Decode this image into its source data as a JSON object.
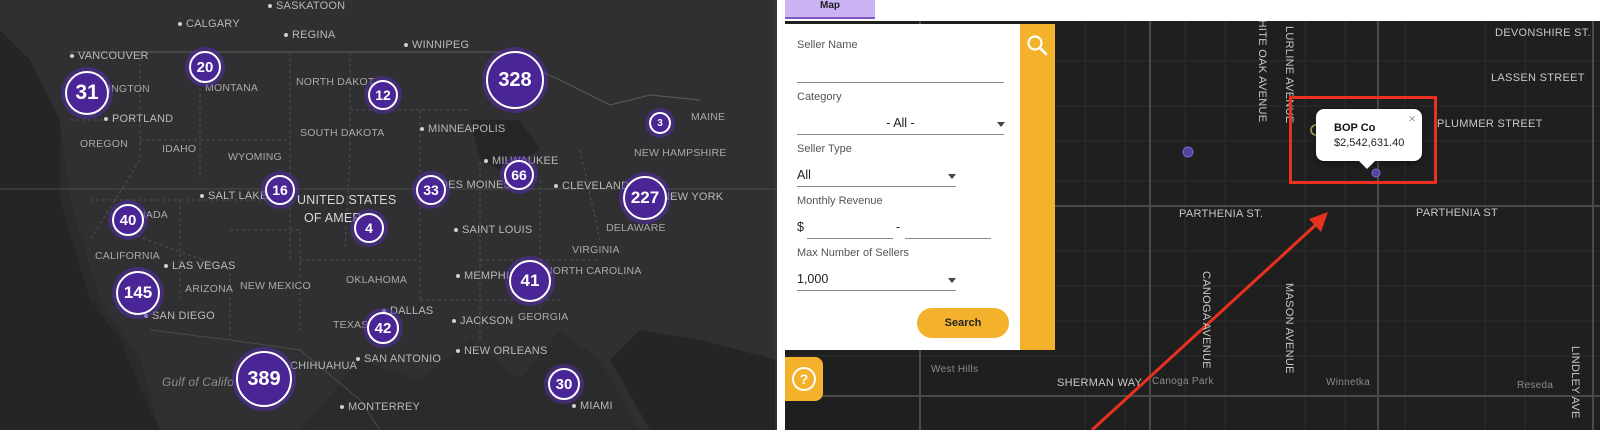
{
  "left_map": {
    "country_labels": [
      "UNITED STATES",
      "OF AMER"
    ],
    "gulf_label": "Gulf of Califo",
    "state_labels": [
      "NORTH DAKOT",
      "MONTANA",
      "SOUTH DAKOTA",
      "WYOMING",
      "IDAHO",
      "OREGON",
      "CALIFORNIA",
      "ARIZONA",
      "NEW MEXICO",
      "OKLAHOMA",
      "TEXAS",
      "GEORGIA",
      "NORTH CAROLINA",
      "VIRGINIA",
      "NEW HAMPSHIRE",
      "MAINE",
      "DELAWARE",
      "NADA",
      "INGTON"
    ],
    "city_labels": [
      "CALGARY",
      "SASKATOON",
      "REGINA",
      "WINNIPEG",
      "VANCOUVER",
      "PORTLAND",
      "MINNEAPOLIS",
      "MILWAUKEE",
      "DES MOINES",
      "SALT LAKE",
      "CLEVELAND",
      "NEW YORK",
      "SAINT LOUIS",
      "LAS VEGAS",
      "SAN DIEGO",
      "MEMPHIS",
      "JACKSON",
      "DALLAS",
      "SAN ANTONIO",
      "NEW ORLEANS",
      "MIAMI",
      "MONTERREY",
      "CHIHUAHUA"
    ],
    "clusters": [
      "31",
      "20",
      "328",
      "12",
      "3",
      "66",
      "33",
      "16",
      "227",
      "40",
      "4",
      "145",
      "41",
      "42",
      "389",
      "30"
    ]
  },
  "tabs": {
    "map_label": "Map"
  },
  "filters": {
    "seller_name_label": "Seller Name",
    "seller_name_value": "",
    "category_label": "Category",
    "category_value": "- All -",
    "seller_type_label": "Seller Type",
    "seller_type_value": "All",
    "monthly_revenue_label": "Monthly Revenue",
    "currency_symbol": "$",
    "range_separator": "-",
    "revenue_min": "",
    "revenue_max": "",
    "max_sellers_label": "Max Number of Sellers",
    "max_sellers_value": "1,000",
    "search_label": "Search",
    "help_glyph": "?"
  },
  "street_map": {
    "streets": [
      "DEVONSHIRE ST.",
      "LASSEN STREET",
      "PLUMMER STREET",
      "PARTHENIA ST.",
      "PARTHENIA ST",
      "SHERMAN WAY"
    ],
    "vertical_streets": [
      "WHITE OAK AVENUE",
      "LURLINE AVENUE",
      "CANOGA AVENUE",
      "MASON AVENUE",
      "LINDLEY AVE"
    ],
    "places": [
      "West Hills",
      "Canoga Park",
      "Winnetka",
      "Reseda"
    ]
  },
  "popup": {
    "seller_name": "BOP Co",
    "revenue": "$2,542,631.40",
    "close_glyph": "×"
  },
  "colors": {
    "accent_purple": "#4a2596",
    "tab_purple": "#ccb3f5",
    "orange": "#f4b22c",
    "highlight_red": "#e8311e"
  }
}
